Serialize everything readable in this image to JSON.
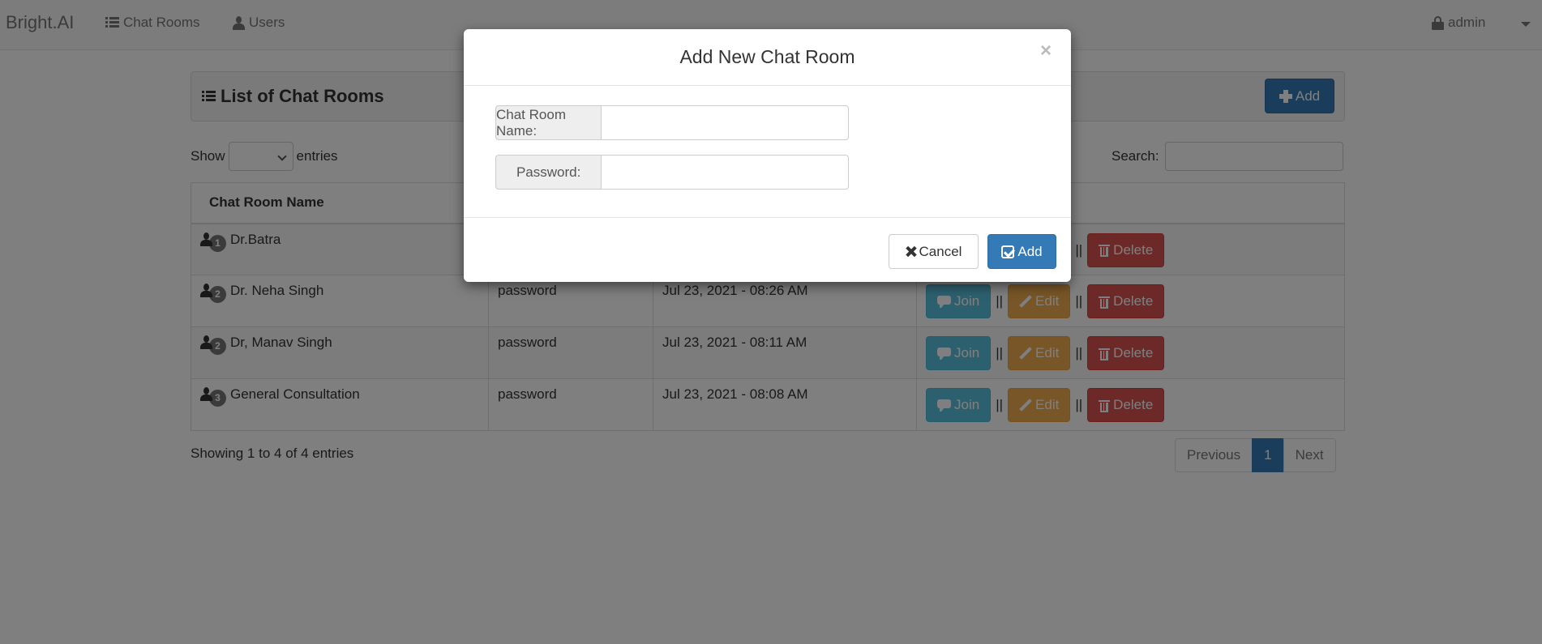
{
  "navbar": {
    "brand": "Bright.AI",
    "items": [
      {
        "label": "Chat Rooms",
        "icon": "list-icon"
      },
      {
        "label": "Users",
        "icon": "user-icon"
      }
    ],
    "user": {
      "label": "admin",
      "icon": "lock-icon"
    }
  },
  "panel": {
    "title": "List of Chat Rooms",
    "add_label": "Add"
  },
  "table_controls": {
    "show_label": "Show",
    "entries_label": "entries",
    "page_size_value": "",
    "search_label": "Search:",
    "search_value": ""
  },
  "table": {
    "columns": [
      "Chat Room Name",
      "",
      "",
      ""
    ],
    "rows": [
      {
        "count": "1",
        "name": "Dr.Batra",
        "password": "",
        "created": ""
      },
      {
        "count": "2",
        "name": "Dr. Neha Singh",
        "password": "password",
        "created": "Jul 23, 2021 - 08:26 AM"
      },
      {
        "count": "2",
        "name": "Dr, Manav Singh",
        "password": "password",
        "created": "Jul 23, 2021 - 08:11 AM"
      },
      {
        "count": "3",
        "name": "General Consultation",
        "password": "password",
        "created": "Jul 23, 2021 - 08:08 AM"
      }
    ],
    "actions": {
      "join": "Join",
      "edit": "Edit",
      "delete": "Delete",
      "separator": "||"
    }
  },
  "footer": {
    "info": "Showing 1 to 4 of 4 entries",
    "pagination": {
      "previous": "Previous",
      "current": "1",
      "next": "Next"
    }
  },
  "modal": {
    "title": "Add New Chat Room",
    "close": "×",
    "fields": [
      {
        "label": "Chat Room Name:",
        "value": "",
        "placeholder": ""
      },
      {
        "label": "Password:",
        "value": "",
        "placeholder": ""
      }
    ],
    "cancel_label": "Cancel",
    "add_label": "Add"
  },
  "colors": {
    "primary": "#337ab7",
    "info": "#5bc0de",
    "warning": "#f0ad4e",
    "danger": "#d9534f",
    "badge": "#777777"
  }
}
